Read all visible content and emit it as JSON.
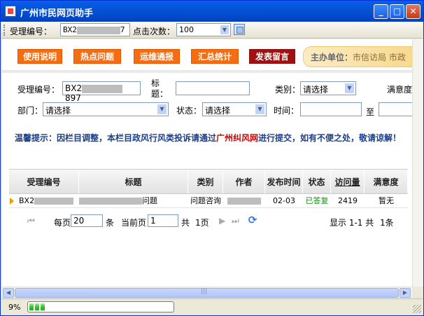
{
  "window": {
    "title": "广州市民网页助手"
  },
  "toolbar": {
    "id_label": "受理编号：",
    "id_value_prefix": "BX2",
    "id_value_suffix": "7",
    "clicks_label": "点击次数：",
    "clicks_value": "100"
  },
  "nav": {
    "buttons": [
      "使用说明",
      "热点问题",
      "运维通报",
      "汇总统计",
      "发表留言"
    ],
    "host_label": "主办单位：",
    "host_value": "市信访局 市政"
  },
  "form": {
    "id_label": "受理编号：",
    "id_value_prefix": "BX2",
    "id_value_suffix": "897",
    "title_label": "标题：",
    "category_label": "类别：",
    "category_value": "请选择",
    "satisfaction_label": "满意度",
    "dept_label": "部门：",
    "dept_value": "请选择",
    "status_label": "状态：",
    "status_value": "请选择",
    "time_label": "时间：",
    "to_label": "至"
  },
  "notice": {
    "part1": "温馨提示：因栏目调整，本栏目政风行风类投诉请通过",
    "link": "广州纠风网",
    "part2": "进行提交，如有不便之处，敬请谅解！"
  },
  "table": {
    "headers": [
      "受理编号",
      "标题",
      "类别",
      "作者",
      "发布时间",
      "状态",
      "访问量",
      "满意度"
    ],
    "rows": [
      {
        "id": "BX2",
        "title": "问题",
        "category": "问题咨询",
        "author": "",
        "date": "02-03",
        "status": "已答复",
        "visits": "2419",
        "satisfaction": "暂无"
      }
    ]
  },
  "pager": {
    "per_page_label": "每页",
    "per_page": "20",
    "unit": "条",
    "current_label": "当前页",
    "current": "1",
    "total_label": "共",
    "total_pages": "1页",
    "summary": "显示 1-1 共",
    "summary_count": "1条"
  },
  "status_bar": {
    "percent": "9%",
    "progress": 0.09
  }
}
